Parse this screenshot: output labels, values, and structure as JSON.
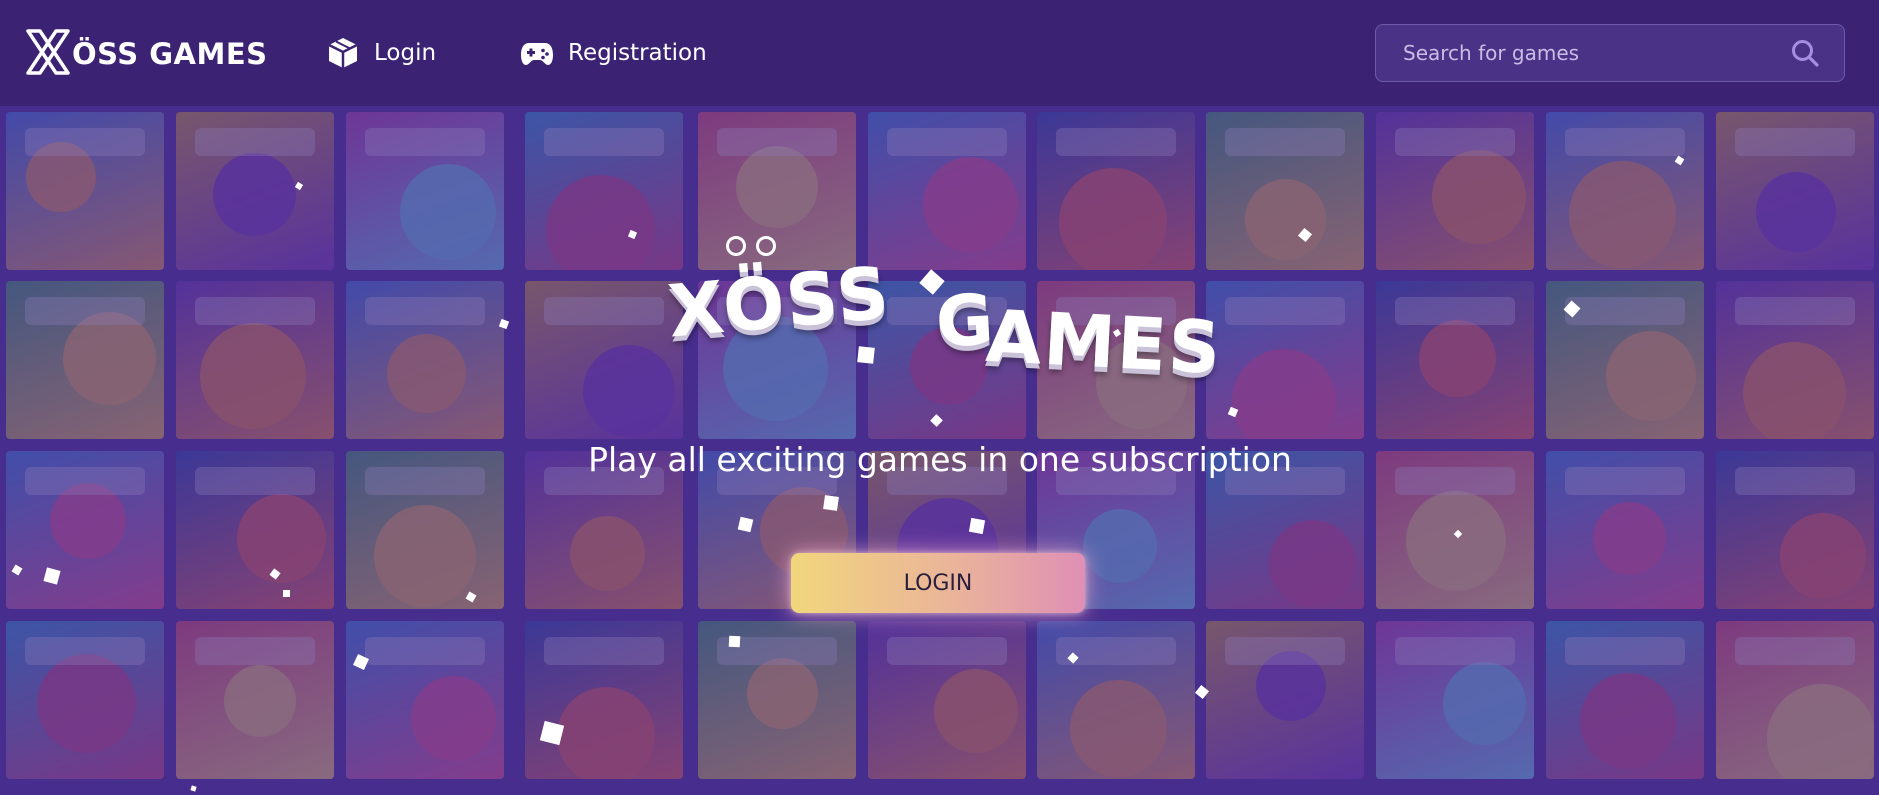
{
  "brand": {
    "name": "ÖSS GAMES",
    "logo_icon": "x-logo-icon"
  },
  "nav": {
    "items": [
      {
        "label": "Login",
        "icon": "cube-icon"
      },
      {
        "label": "Registration",
        "icon": "gamepad-icon"
      }
    ]
  },
  "search": {
    "placeholder": "Search for games",
    "value": ""
  },
  "hero": {
    "title_word1": "XÖSS",
    "title_word2_first": "G",
    "title_word2_rest": "AMES",
    "tagline": "Play all exciting games in one subscription",
    "button_label": "LOGIN"
  },
  "colors": {
    "header_bg": "#3b2273",
    "overlay": "#462a8c",
    "button_gradient": [
      "#f1d67c",
      "#eab49a",
      "#df8fb5"
    ]
  }
}
